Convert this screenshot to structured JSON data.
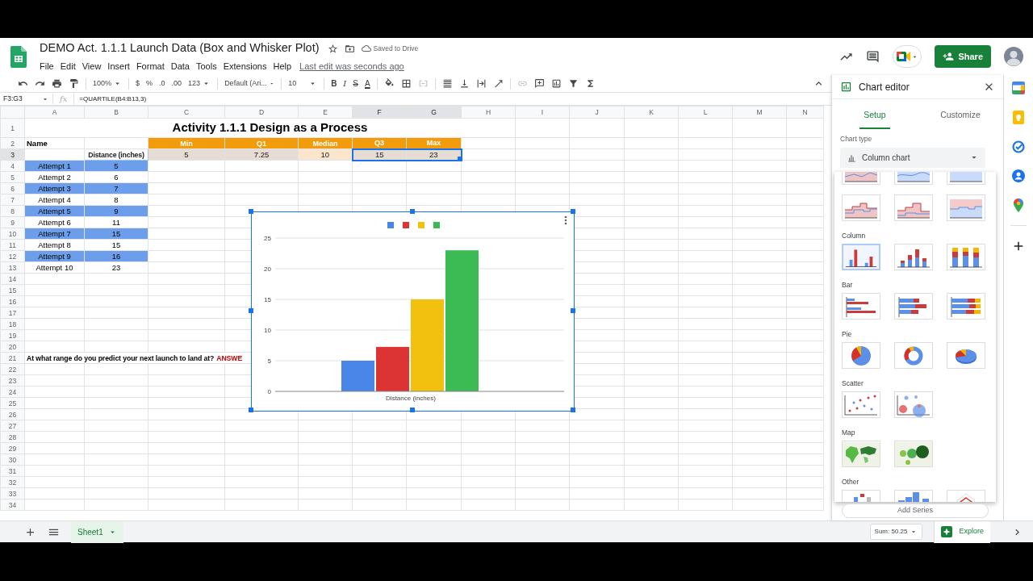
{
  "document": {
    "title": "DEMO Act. 1.1.1 Launch Data (Box and Whisker Plot)",
    "starred": false,
    "save_status": "Saved to Drive"
  },
  "menus": [
    "File",
    "Edit",
    "View",
    "Insert",
    "Format",
    "Data",
    "Tools",
    "Extensions",
    "Help"
  ],
  "last_edit": "Last edit was seconds ago",
  "share": "Share",
  "toolbar": {
    "zoom": "100%",
    "currency": "$",
    "percent": "%",
    "decimals_less": ".0",
    "decimals_more": ".00",
    "number_format": "123",
    "font": "Default (Ari...",
    "font_size": "10",
    "bold": "B",
    "italic": "I",
    "strike": "S",
    "text_color": "A"
  },
  "formula_bar": {
    "name_box": "F3:G3",
    "fx": "fx",
    "formula": "=QUARTILE(B4:B13,3)"
  },
  "columns": [
    {
      "label": "A",
      "selected": false
    },
    {
      "label": "B",
      "selected": false
    },
    {
      "label": "C",
      "selected": false
    },
    {
      "label": "D",
      "selected": false
    },
    {
      "label": "E",
      "selected": false
    },
    {
      "label": "F",
      "selected": true
    },
    {
      "label": "G",
      "selected": true
    },
    {
      "label": "H",
      "selected": false
    },
    {
      "label": "I",
      "selected": false
    },
    {
      "label": "J",
      "selected": false
    },
    {
      "label": "K",
      "selected": false
    },
    {
      "label": "L",
      "selected": false
    },
    {
      "label": "M",
      "selected": false
    },
    {
      "label": "N",
      "selected": false
    }
  ],
  "rows": [
    {
      "label": "1",
      "selected": false
    },
    {
      "label": "2",
      "selected": false
    },
    {
      "label": "3",
      "selected": true
    },
    {
      "label": "4",
      "selected": false
    },
    {
      "label": "5",
      "selected": false
    },
    {
      "label": "6",
      "selected": false
    },
    {
      "label": "7",
      "selected": false
    },
    {
      "label": "8",
      "selected": false
    },
    {
      "label": "9",
      "selected": false
    },
    {
      "label": "10",
      "selected": false
    },
    {
      "label": "11",
      "selected": false
    },
    {
      "label": "12",
      "selected": false
    },
    {
      "label": "13",
      "selected": false
    },
    {
      "label": "14",
      "selected": false
    },
    {
      "label": "15",
      "selected": false
    },
    {
      "label": "16",
      "selected": false
    },
    {
      "label": "17",
      "selected": false
    },
    {
      "label": "18",
      "selected": false
    },
    {
      "label": "19",
      "selected": false
    },
    {
      "label": "20",
      "selected": false
    },
    {
      "label": "21",
      "selected": false
    },
    {
      "label": "22",
      "selected": false
    },
    {
      "label": "23",
      "selected": false
    },
    {
      "label": "24",
      "selected": false
    },
    {
      "label": "25",
      "selected": false
    },
    {
      "label": "26",
      "selected": false
    },
    {
      "label": "27",
      "selected": false
    },
    {
      "label": "28",
      "selected": false
    },
    {
      "label": "29",
      "selected": false
    },
    {
      "label": "30",
      "selected": false
    },
    {
      "label": "31",
      "selected": false
    },
    {
      "label": "32",
      "selected": false
    },
    {
      "label": "33",
      "selected": false
    },
    {
      "label": "34",
      "selected": false
    }
  ],
  "title": "Activity 1.1.1 Design as a Process",
  "name_header": "Name",
  "distance_header": "Distance (inches)",
  "stats": [
    {
      "label": "Min",
      "value": "5",
      "color": "#e6dcd3",
      "selected": false
    },
    {
      "label": "Q1",
      "value": "7.25",
      "color": "#e6dcd3",
      "selected": false
    },
    {
      "label": "Median",
      "value": "10",
      "color": "#fce5cd",
      "selected": false
    },
    {
      "label": "Q3",
      "value": "15",
      "color": "#e6dcd3",
      "selected": true
    },
    {
      "label": "Max",
      "value": "23",
      "color": "#e6dcd3",
      "selected": true
    }
  ],
  "attempts": [
    {
      "name": "Attempt 1",
      "distance": "5",
      "highlighted": true
    },
    {
      "name": "Attempt 2",
      "distance": "6",
      "highlighted": false
    },
    {
      "name": "Attempt 3",
      "distance": "7",
      "highlighted": true
    },
    {
      "name": "Attempt 4",
      "distance": "8",
      "highlighted": false
    },
    {
      "name": "Attempt 5",
      "distance": "9",
      "highlighted": true
    },
    {
      "name": "Attempt 6",
      "distance": "11",
      "highlighted": false
    },
    {
      "name": "Attempt 7",
      "distance": "15",
      "highlighted": true
    },
    {
      "name": "Attempt 8",
      "distance": "15",
      "highlighted": false
    },
    {
      "name": "Attempt 9",
      "distance": "16",
      "highlighted": true
    },
    {
      "name": "Attempt 10",
      "distance": "23",
      "highlighted": false
    }
  ],
  "question": "At what range do you predict your next launch to land at?",
  "answer": "ANSWE",
  "chart": {
    "chart_data": {
      "type": "bar",
      "orientation": "vertical",
      "categories": [
        "Distance (inches)"
      ],
      "ylim": [
        0,
        25
      ],
      "grid": true,
      "yticks": [
        0,
        5,
        10,
        15,
        20,
        25
      ],
      "series": [
        {
          "color": "#4a86e8",
          "values": [
            5
          ]
        },
        {
          "color": "#dc3434",
          "values": [
            7.25
          ]
        },
        {
          "color": "#f2c10f",
          "values": [
            15
          ]
        },
        {
          "color": "#3cba54",
          "values": [
            23
          ]
        }
      ]
    }
  },
  "sheet_tabs": [
    {
      "label": "Sheet1",
      "selected": true
    }
  ],
  "sum": "Sum: 50.25",
  "explore": "Explore",
  "chart_editor": {
    "title": "Chart editor",
    "tabs": [
      {
        "label": "Setup",
        "selected": true
      },
      {
        "label": "Customize",
        "selected": false
      }
    ],
    "chart_type_label": "Chart type",
    "chart_type": "Column chart",
    "groups": [
      {
        "options": [
          {
            "kind": "area",
            "selected": false
          },
          {
            "kind": "smootharea",
            "selected": false
          },
          {
            "kind": "percentarea",
            "selected": false
          }
        ]
      },
      {
        "options": [
          {
            "kind": "steppedarea",
            "selected": false
          },
          {
            "kind": "stackedsteppedarea",
            "selected": false
          },
          {
            "kind": "percentsteppedarea",
            "selected": false
          }
        ]
      },
      {
        "label": "Column",
        "options": [
          {
            "kind": "column",
            "selected": true
          },
          {
            "kind": "stackedcolumn",
            "selected": false
          },
          {
            "kind": "percentcolumn",
            "selected": false
          }
        ]
      },
      {
        "label": "Bar",
        "options": [
          {
            "kind": "bar",
            "selected": false
          },
          {
            "kind": "stackedbar",
            "selected": false
          },
          {
            "kind": "percentbar",
            "selected": false
          }
        ]
      },
      {
        "label": "Pie",
        "options": [
          {
            "kind": "pie",
            "selected": false
          },
          {
            "kind": "donut",
            "selected": false
          },
          {
            "kind": "pie3d",
            "selected": false
          }
        ]
      },
      {
        "label": "Scatter",
        "options": [
          {
            "kind": "scatter",
            "selected": false
          },
          {
            "kind": "bubble",
            "selected": false
          }
        ]
      },
      {
        "label": "Map",
        "options": [
          {
            "kind": "geo",
            "selected": false
          },
          {
            "kind": "geobubble",
            "selected": false
          }
        ]
      },
      {
        "label": "Other",
        "options": [
          {
            "kind": "waterfall",
            "selected": false
          },
          {
            "kind": "histogram",
            "selected": false
          },
          {
            "kind": "radar",
            "selected": false
          }
        ]
      }
    ],
    "add_series": "Add Series"
  }
}
